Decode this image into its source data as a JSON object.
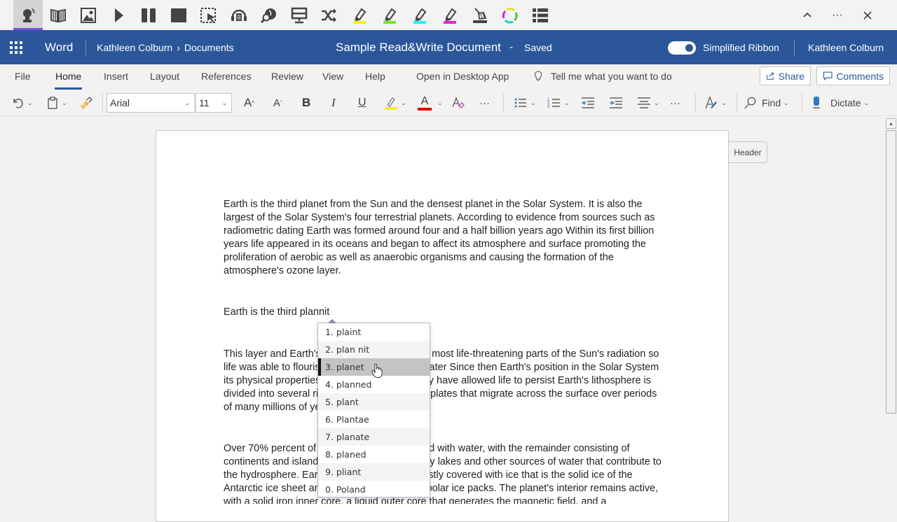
{
  "rw_toolbar": {
    "icons": [
      {
        "name": "predict-icon",
        "active": true
      },
      {
        "name": "dictionary-icon"
      },
      {
        "name": "picture-dictionary-icon"
      },
      {
        "name": "play-icon"
      },
      {
        "name": "pause-icon"
      },
      {
        "name": "stop-icon"
      },
      {
        "name": "screenshot-reader-icon"
      },
      {
        "name": "audio-maker-icon"
      },
      {
        "name": "check-it-icon"
      },
      {
        "name": "screen-mask-icon"
      },
      {
        "name": "translator-icon"
      },
      {
        "name": "highlight-yellow-icon"
      },
      {
        "name": "highlight-green-icon"
      },
      {
        "name": "highlight-cyan-icon"
      },
      {
        "name": "highlight-pink-icon"
      },
      {
        "name": "clear-highlights-icon"
      },
      {
        "name": "collect-highlights-icon"
      },
      {
        "name": "vocabulary-list-icon"
      }
    ],
    "highlight_colors": {
      "yellow": "#f5f500",
      "green": "#66ee22",
      "cyan": "#22eeee",
      "pink": "#ee22dd"
    },
    "window_controls": {
      "collapse": "⌃",
      "more": "···",
      "close": "✕"
    }
  },
  "header": {
    "app_name": "Word",
    "breadcrumb": {
      "owner": "Kathleen Colburn",
      "separator": "›",
      "folder": "Documents"
    },
    "doc_title": "Sample Read&Write Document",
    "dash": "-",
    "status": "Saved",
    "toggle_label": "Simplified Ribbon",
    "toggle_on": true,
    "user": "Kathleen Colburn",
    "brand_color": "#2b579a"
  },
  "tabs": {
    "items": [
      "File",
      "Home",
      "Insert",
      "Layout",
      "References",
      "Review",
      "View",
      "Help",
      "Open in Desktop App"
    ],
    "active": "Home",
    "tell_me": "Tell me what you want to do",
    "share": "Share",
    "comments": "Comments"
  },
  "ribbon": {
    "font_name": "Arial",
    "font_size": "11",
    "bold": "B",
    "italic": "I",
    "underline": "U",
    "grow": "A",
    "shrink": "A",
    "font_color_letter": "A",
    "more": "···",
    "find": "Find",
    "dictate": "Dictate"
  },
  "document": {
    "header_tag": "Header",
    "paragraphs": [
      "Earth is the third planet from the Sun and the densest planet in the Solar System. It is also the largest of the Solar System's four terrestrial planets. According to evidence from sources such as radiometric dating Earth was formed around four and a half billion years ago Within its first billion years life appeared in its oceans and began to affect its atmosphere and surface promoting the proliferation of aerobic as well as anaerobic organisms and causing the formation of the atmosphere's ozone layer.",
      "Earth is the third plannit",
      "This layer and Earth's magnetic field block the most life-threatening parts of the Sun's radiation so life was able to flourish on land as well as in water Since then Earth's position in the Solar System its physical properties and its geological history have allowed life to persist Earth's lithosphere is divided into several rigid segments or tectonic plates that migrate across the surface over periods of many millions of years.",
      "Over 70% percent of Earth's surface is covered with water, with the remainder consisting of continents and islands that together have many lakes and other sources of water that contribute to the hydrosphere. Earth's polar regions are mostly covered with ice that is the solid ice of the Antarctic ice sheet and the sea ice that is the polar ice packs. The planet's interior remains active, with a solid iron inner core, a liquid outer core that generates the magnetic field, and a"
    ]
  },
  "prediction": {
    "selected_index": 2,
    "items": [
      "1. plaint",
      "2. plan nit",
      "3. planet",
      "4. planned",
      "5. plant",
      "6. Plantae",
      "7. planate",
      "8. planed",
      "9. pliant",
      "0. Poland"
    ]
  }
}
